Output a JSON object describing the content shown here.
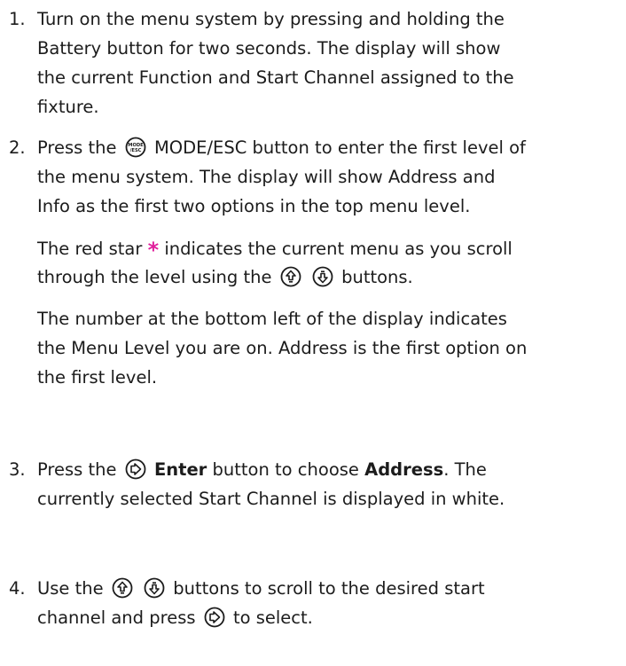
{
  "steps": [
    {
      "num": "1.",
      "lines": [
        "Turn on the menu system by pressing and holding the",
        "Battery button for two seconds. The display will show",
        "the current Function and Start Channel assigned to the",
        "fixture."
      ]
    },
    {
      "num": "2.",
      "l1_a": "Press the",
      "mode_icon_label": "MODE /ESC",
      "l1_b": "MODE/ESC button to enter the first level of",
      "lines": [
        "the menu system. The display will show Address and",
        "Info as the first two options in the top menu level."
      ],
      "p2_a": "The red star",
      "star": "*",
      "p2_b": "indicates the current menu as you scroll",
      "p2_c": "through the level using the",
      "p2_d": "buttons.",
      "p3": [
        "The number at the bottom left of the display indicates",
        "the Menu Level you are on. Address is the first option on",
        "the first level."
      ]
    },
    {
      "num": "3.",
      "a": "Press the",
      "enter": "Enter",
      "b": "button to choose",
      "address": "Address",
      "c": ". The",
      "line2": "currently selected Start Channel is displayed in white."
    },
    {
      "num": "4.",
      "a": "Use the",
      "b": "buttons to scroll to the desired start",
      "c": "channel and press",
      "d": "to select."
    }
  ],
  "icons": [
    "mode-esc-icon",
    "up-arrow-icon",
    "down-arrow-icon",
    "enter-icon"
  ],
  "colors": {
    "star": "#e0209c",
    "text": "#1c1c1c"
  }
}
